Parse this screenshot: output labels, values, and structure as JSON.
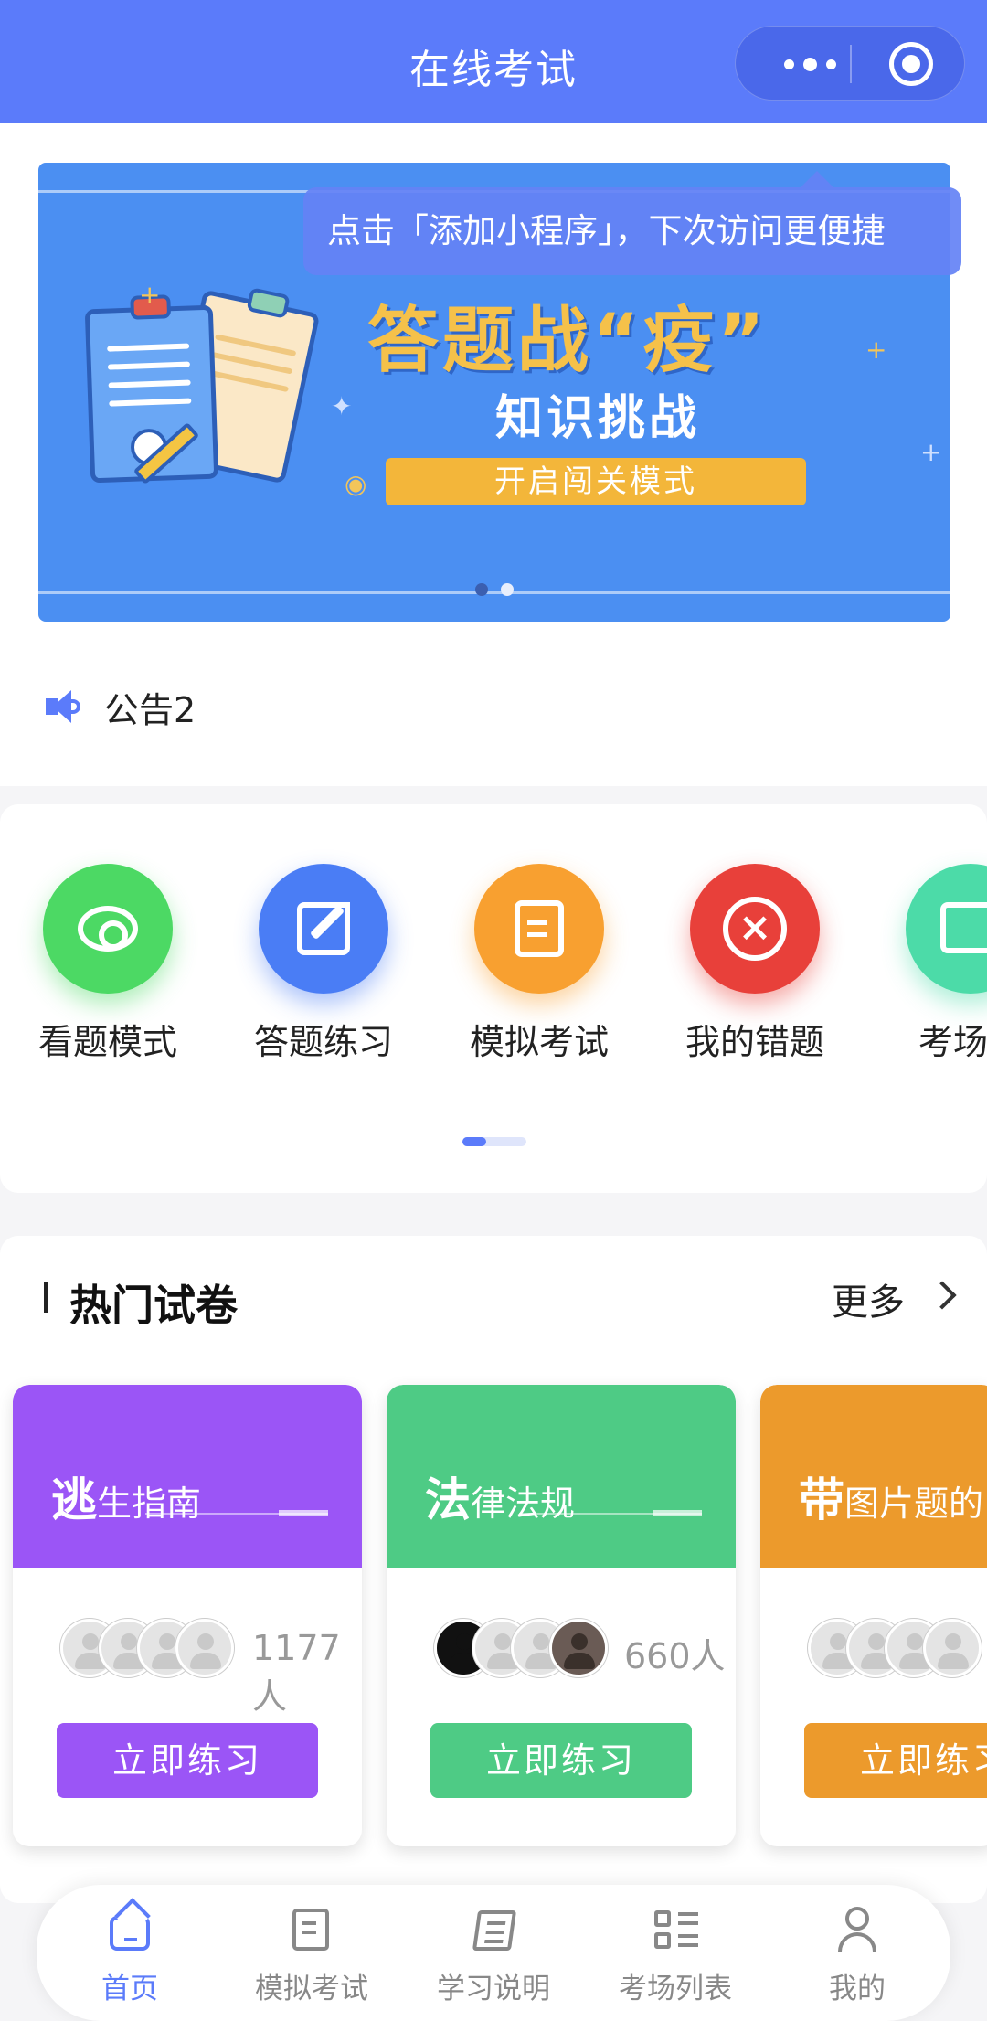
{
  "header": {
    "title": "在线考试"
  },
  "tooltip": {
    "text": "点击「添加小程序」，下次访问更便捷"
  },
  "banner": {
    "title": "答题战“疫”",
    "subtitle": "知识挑战",
    "button": "开启闯关模式",
    "dots": 2,
    "active_dot": 2
  },
  "notice": {
    "text": "公告2",
    "icon": "speaker-icon"
  },
  "menu": {
    "items": [
      {
        "label": "看题模式",
        "color": "#4cd964",
        "icon": "eye-icon"
      },
      {
        "label": "答题练习",
        "color": "#4a7df5",
        "icon": "edit-icon"
      },
      {
        "label": "模拟考试",
        "color": "#f8a030",
        "icon": "note-icon"
      },
      {
        "label": "我的错题",
        "color": "#e8403a",
        "icon": "close-circle-icon"
      },
      {
        "label": "考场排",
        "color": "#4cdba8",
        "icon": "chart-icon"
      }
    ]
  },
  "hot": {
    "title": "热门试卷",
    "more": "更多",
    "cards": [
      {
        "title_first": "逃",
        "title_rest": "生指南",
        "count": "1177人",
        "button": "立即练习",
        "color": "#9b55f6"
      },
      {
        "title_first": "法",
        "title_rest": "律法规",
        "count": "660人",
        "button": "立即练习",
        "color": "#4ecb85"
      },
      {
        "title_first": "带",
        "title_rest": "图片题的",
        "count": "",
        "button": "立即练习",
        "color": "#ec9a2c"
      }
    ]
  },
  "tabbar": {
    "tabs": [
      {
        "label": "首页",
        "icon": "home-icon",
        "active": true
      },
      {
        "label": "模拟考试",
        "icon": "exam-icon",
        "active": false
      },
      {
        "label": "学习说明",
        "icon": "book-icon",
        "active": false
      },
      {
        "label": "考场列表",
        "icon": "list-icon",
        "active": false
      },
      {
        "label": "我的",
        "icon": "user-icon",
        "active": false
      }
    ]
  }
}
